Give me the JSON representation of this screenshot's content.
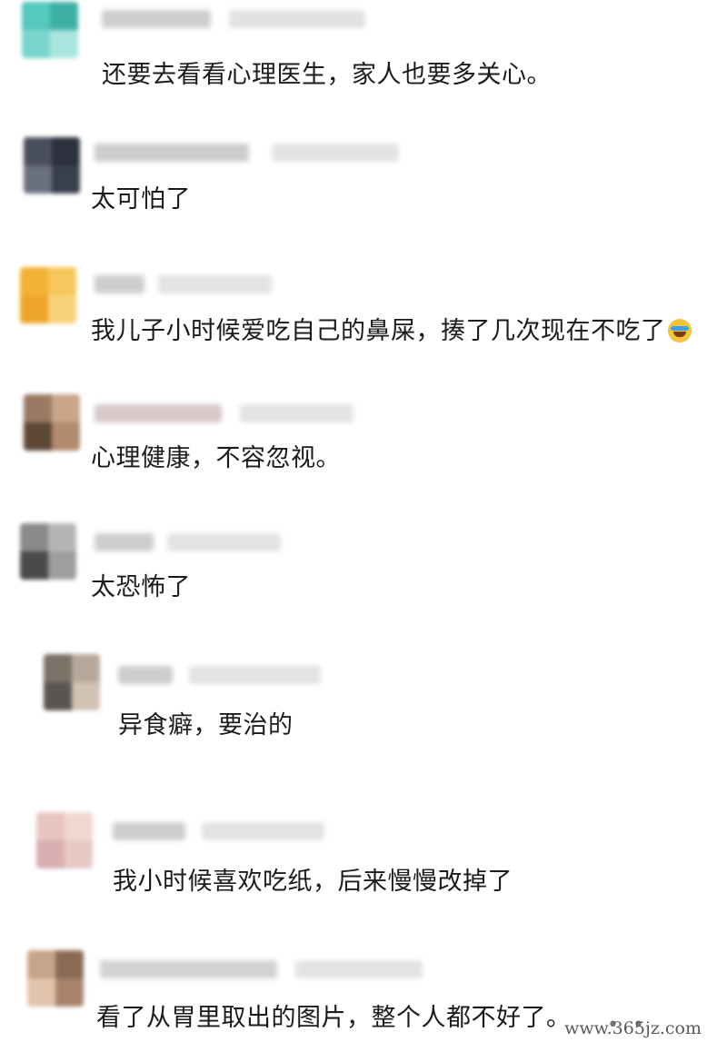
{
  "comments": [
    {
      "text": "还要去看看心理医生，家人也要多关心。"
    },
    {
      "text": "太可怕了"
    },
    {
      "text": "我儿子小时候爱吃自己的鼻屎，揍了几次现在不吃了"
    },
    {
      "text": "心理健康，不容忽视。"
    },
    {
      "text": "太恐怖了"
    },
    {
      "text": "异食癖，要治的"
    },
    {
      "text": "我小时候喜欢吃纸，后来慢慢改掉了"
    },
    {
      "text": "看了从胃里取出的图片，整个人都不好了。"
    }
  ],
  "emoji_icon": "laughing-crying-emoji-icon",
  "watermark": "www.365jz.com",
  "colors": {
    "text": "#1b1b1b",
    "background": "#ffffff",
    "blur_gray": "#d8d8d8"
  }
}
